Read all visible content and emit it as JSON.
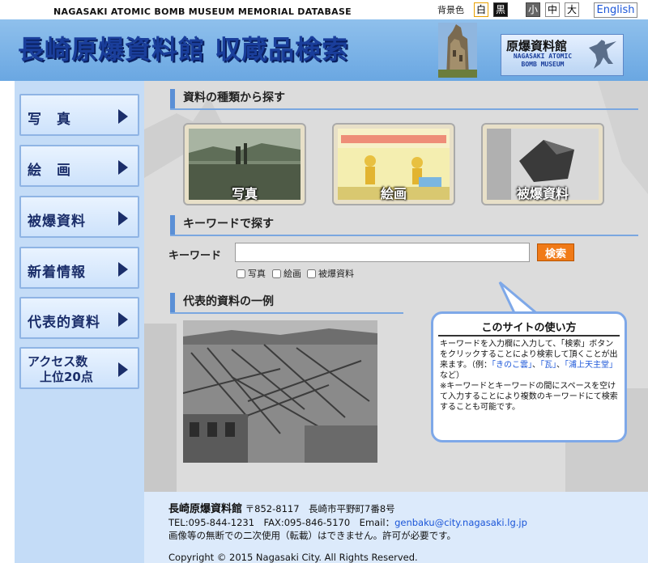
{
  "top": {
    "db_title": "NAGASAKI ATOMIC BOMB MUSEUM MEMORIAL DATABASE",
    "bgcolor_label": "背景色",
    "bg_white": "白",
    "bg_black": "黒",
    "font_small": "小",
    "font_medium": "中",
    "font_large": "大",
    "english": "English"
  },
  "header": {
    "title": "長崎原爆資料館 収蔵品検索",
    "logo_jp": "原爆資料館",
    "logo_en": "NAGASAKI ATOMIC BOMB MUSEUM"
  },
  "sidebar": {
    "items": [
      {
        "label": "写　真"
      },
      {
        "label": "絵　画"
      },
      {
        "label": "被爆資料"
      },
      {
        "label": "新着情報"
      },
      {
        "label": "代表的資料"
      },
      {
        "label": "アクセス数\n　上位20点"
      }
    ]
  },
  "sections": {
    "browse": "資料の種類から探す",
    "keyword": "キーワードで探す",
    "featured": "代表的資料の一例"
  },
  "categories": [
    {
      "label": "写真"
    },
    {
      "label": "絵画"
    },
    {
      "label": "被爆資料"
    }
  ],
  "search": {
    "label": "キーワード",
    "value": "",
    "button": "検索",
    "filters": [
      "写真",
      "絵画",
      "被爆資料"
    ]
  },
  "howto": {
    "title": "このサイトの使い方",
    "p1": "キーワードを入力欄に入力して、「検索」ボタンをクリックすることにより検索して頂くことが出来ます。（例：",
    "ex1": "「きのこ雲」",
    "sep1": "、",
    "ex2": "「瓦」",
    "sep2": "、",
    "ex3": "「浦上天主堂」",
    "p1_end": "　など）",
    "p2": "※キーワードとキーワードの間にスペースを空けて入力することにより複数のキーワードにて検索することも可能です。"
  },
  "footer": {
    "name": "長崎原爆資料館",
    "address": "〒852-8117　長崎市平野町7番8号",
    "tel_fax": "TEL:095-844-1231　FAX:095-846-5170　Email：",
    "email": "genbaku@city.nagasaki.lg.jp",
    "notice": "画像等の無断での二次使用（転載）はできません。許可が必要です。",
    "copyright": "Copyright © 2015 Nagasaki City. All Rights Reserved."
  },
  "colors": {
    "banner": "#7ab3e8",
    "title": "#1a3e9b",
    "sidebar": "#c4dcf7",
    "search_button": "#f07a18"
  }
}
